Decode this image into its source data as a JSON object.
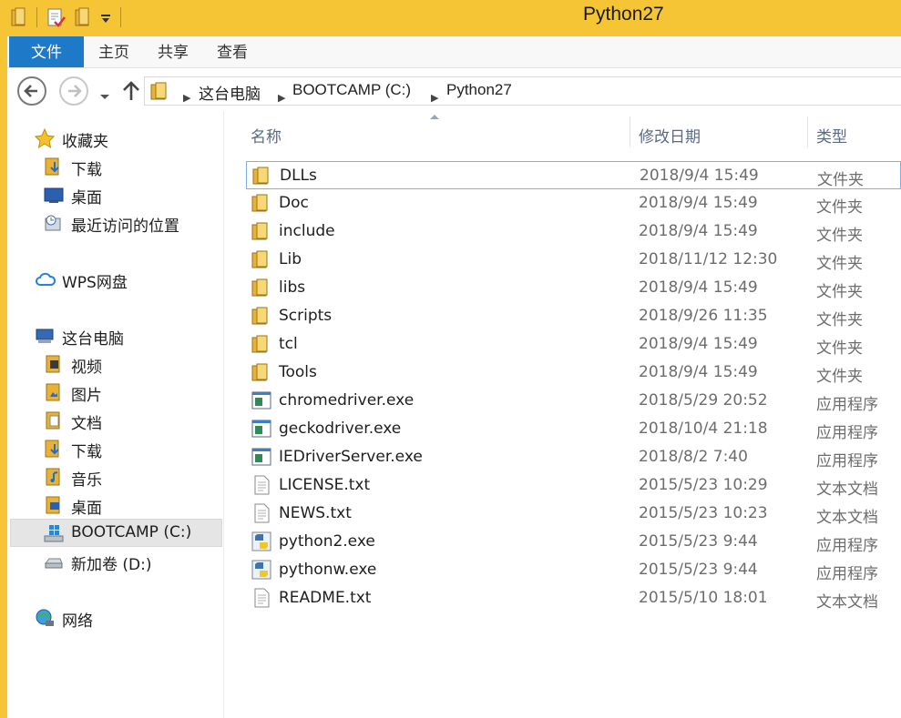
{
  "window": {
    "title": "Python27"
  },
  "ribbon": {
    "tabs": [
      "文件",
      "主页",
      "共享",
      "查看"
    ]
  },
  "address": {
    "crumbs": [
      "这台电脑",
      "BOOTCAMP (C:)",
      "Python27"
    ]
  },
  "nav": {
    "favorites": "收藏夹",
    "fav_items": [
      "下载",
      "桌面",
      "最近访问的位置"
    ],
    "wps": "WPS网盘",
    "thispc": "这台电脑",
    "pc_items": [
      "视频",
      "图片",
      "文档",
      "下载",
      "音乐",
      "桌面",
      "BOOTCAMP (C:)",
      "新加卷 (D:)"
    ],
    "network": "网络"
  },
  "columns": {
    "name": "名称",
    "date": "修改日期",
    "type": "类型"
  },
  "files": [
    {
      "name": "DLLs",
      "date": "2018/9/4 15:49",
      "type": "文件夹",
      "icon": "folder"
    },
    {
      "name": "Doc",
      "date": "2018/9/4 15:49",
      "type": "文件夹",
      "icon": "folder"
    },
    {
      "name": "include",
      "date": "2018/9/4 15:49",
      "type": "文件夹",
      "icon": "folder"
    },
    {
      "name": "Lib",
      "date": "2018/11/12 12:30",
      "type": "文件夹",
      "icon": "folder"
    },
    {
      "name": "libs",
      "date": "2018/9/4 15:49",
      "type": "文件夹",
      "icon": "folder"
    },
    {
      "name": "Scripts",
      "date": "2018/9/26 11:35",
      "type": "文件夹",
      "icon": "folder"
    },
    {
      "name": "tcl",
      "date": "2018/9/4 15:49",
      "type": "文件夹",
      "icon": "folder"
    },
    {
      "name": "Tools",
      "date": "2018/9/4 15:49",
      "type": "文件夹",
      "icon": "folder"
    },
    {
      "name": "chromedriver.exe",
      "date": "2018/5/29 20:52",
      "type": "应用程序",
      "icon": "exe"
    },
    {
      "name": "geckodriver.exe",
      "date": "2018/10/4 21:18",
      "type": "应用程序",
      "icon": "exe"
    },
    {
      "name": "IEDriverServer.exe",
      "date": "2018/8/2 7:40",
      "type": "应用程序",
      "icon": "exe"
    },
    {
      "name": "LICENSE.txt",
      "date": "2015/5/23 10:29",
      "type": "文本文档",
      "icon": "txt"
    },
    {
      "name": "NEWS.txt",
      "date": "2015/5/23 10:23",
      "type": "文本文档",
      "icon": "txt"
    },
    {
      "name": "python2.exe",
      "date": "2015/5/23 9:44",
      "type": "应用程序",
      "icon": "python"
    },
    {
      "name": "pythonw.exe",
      "date": "2015/5/23 9:44",
      "type": "应用程序",
      "icon": "python"
    },
    {
      "name": "README.txt",
      "date": "2015/5/10 18:01",
      "type": "文本文档",
      "icon": "txt"
    }
  ],
  "colors": {
    "titlebar": "#f5c535",
    "file_tab": "#1e79c9",
    "selection_border": "#7db0e5"
  }
}
